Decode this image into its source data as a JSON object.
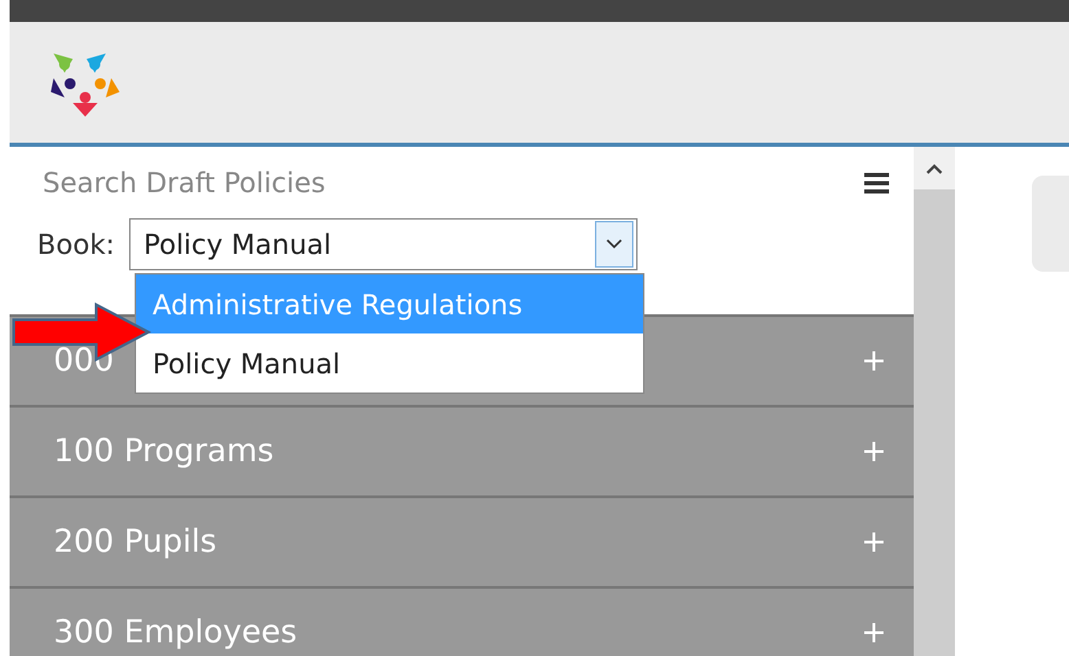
{
  "sidebar": {
    "search": {
      "placeholder": "Search Draft Policies"
    },
    "book": {
      "label": "Book:",
      "value": "Policy Manual",
      "open": true,
      "options": [
        {
          "label": "Administrative Regulations",
          "highlighted": true
        },
        {
          "label": "Policy Manual",
          "highlighted": false
        }
      ]
    },
    "sections": [
      {
        "label": "000",
        "expanded": false
      },
      {
        "label": "100 Programs",
        "expanded": false
      },
      {
        "label": "200 Pupils",
        "expanded": false
      },
      {
        "label": "300 Employees",
        "expanded": false
      }
    ]
  }
}
